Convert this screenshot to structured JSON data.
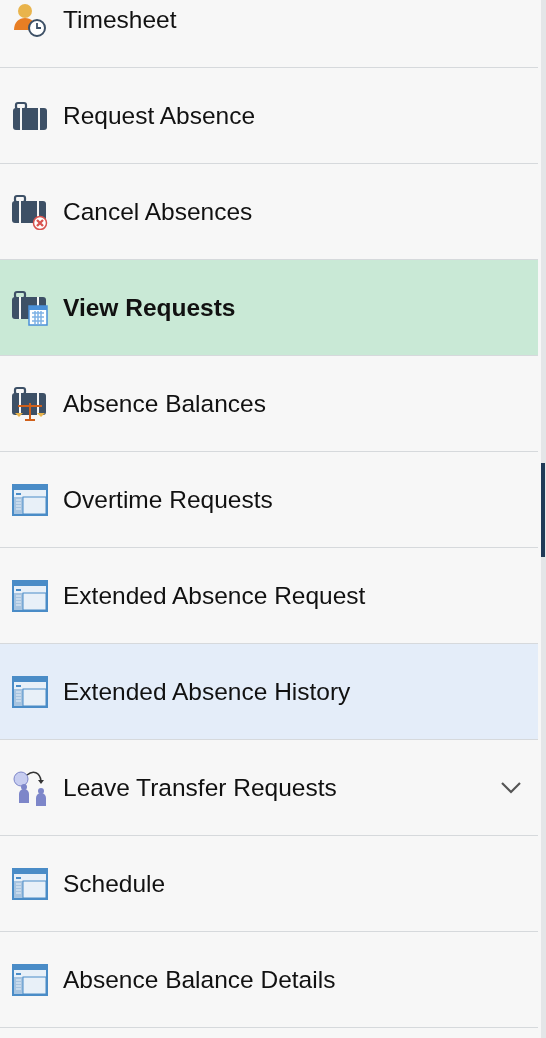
{
  "menu": {
    "items": [
      {
        "label": "Timesheet",
        "kind": "timesheet",
        "selected": false,
        "highlighted": false,
        "has_submenu": false
      },
      {
        "label": "Request Absence",
        "kind": "briefcase",
        "selected": false,
        "highlighted": false,
        "has_submenu": false
      },
      {
        "label": "Cancel Absences",
        "kind": "briefcase-cancel",
        "selected": false,
        "highlighted": false,
        "has_submenu": false
      },
      {
        "label": "View Requests",
        "kind": "briefcase-calendar",
        "selected": true,
        "highlighted": false,
        "has_submenu": false
      },
      {
        "label": "Absence Balances",
        "kind": "briefcase-scales",
        "selected": false,
        "highlighted": false,
        "has_submenu": false
      },
      {
        "label": "Overtime Requests",
        "kind": "page",
        "selected": false,
        "highlighted": false,
        "has_submenu": false
      },
      {
        "label": "Extended Absence Request",
        "kind": "page",
        "selected": false,
        "highlighted": false,
        "has_submenu": false
      },
      {
        "label": "Extended Absence History",
        "kind": "page",
        "selected": false,
        "highlighted": true,
        "has_submenu": false
      },
      {
        "label": "Leave Transfer Requests",
        "kind": "transfer",
        "selected": false,
        "highlighted": false,
        "has_submenu": true
      },
      {
        "label": "Schedule",
        "kind": "page",
        "selected": false,
        "highlighted": false,
        "has_submenu": false
      },
      {
        "label": "Absence Balance Details",
        "kind": "page",
        "selected": false,
        "highlighted": false,
        "has_submenu": false
      }
    ]
  }
}
